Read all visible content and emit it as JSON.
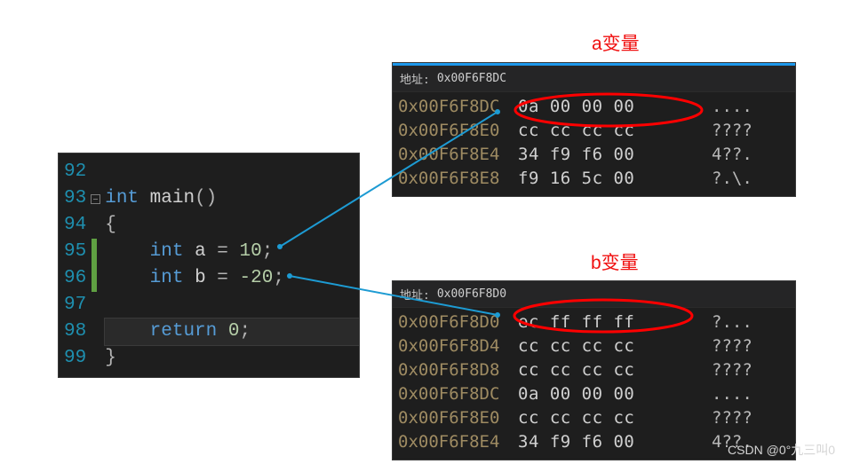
{
  "labels": {
    "var_a": "a变量",
    "var_b": "b变量"
  },
  "code": {
    "lines": [
      "92",
      "93",
      "94",
      "95",
      "96",
      "97",
      "98",
      "99"
    ],
    "decl": {
      "kw_int": "int",
      "func": "main",
      "paren": "()"
    },
    "body": {
      "lbrace": "{",
      "a_line": {
        "kw": "int",
        "name": "a",
        "assign": "=",
        "val": "10",
        "semi": ";"
      },
      "b_line": {
        "kw": "int",
        "name": "b",
        "assign": "=",
        "val": "-20",
        "semi": ";"
      },
      "blank1": "",
      "ret": {
        "kw": "return",
        "val": "0",
        "semi": ";"
      },
      "rbrace": "}"
    }
  },
  "mem_a": {
    "addr_label": "地址:",
    "addr_input": "0x00F6F8DC",
    "rows": [
      {
        "addr": "0x00F6F8DC",
        "bytes": "0a 00 00 00",
        "ascii": "...."
      },
      {
        "addr": "0x00F6F8E0",
        "bytes": "cc cc cc cc",
        "ascii": "????"
      },
      {
        "addr": "0x00F6F8E4",
        "bytes": "34 f9 f6 00",
        "ascii": "4??."
      },
      {
        "addr": "0x00F6F8E8",
        "bytes": "f9 16 5c 00",
        "ascii": "?.\\."
      }
    ]
  },
  "mem_b": {
    "addr_label": "地址:",
    "addr_input": "0x00F6F8D0",
    "rows": [
      {
        "addr": "0x00F6F8D0",
        "bytes": "ec ff ff ff",
        "ascii": "?..."
      },
      {
        "addr": "0x00F6F8D4",
        "bytes": "cc cc cc cc",
        "ascii": "????"
      },
      {
        "addr": "0x00F6F8D8",
        "bytes": "cc cc cc cc",
        "ascii": "????"
      },
      {
        "addr": "0x00F6F8DC",
        "bytes": "0a 00 00 00",
        "ascii": "...."
      },
      {
        "addr": "0x00F6F8E0",
        "bytes": "cc cc cc cc",
        "ascii": "????"
      },
      {
        "addr": "0x00F6F8E4",
        "bytes": "34 f9 f6 00",
        "ascii": "4??."
      }
    ]
  },
  "watermark": "CSDN @0°九三叫0"
}
